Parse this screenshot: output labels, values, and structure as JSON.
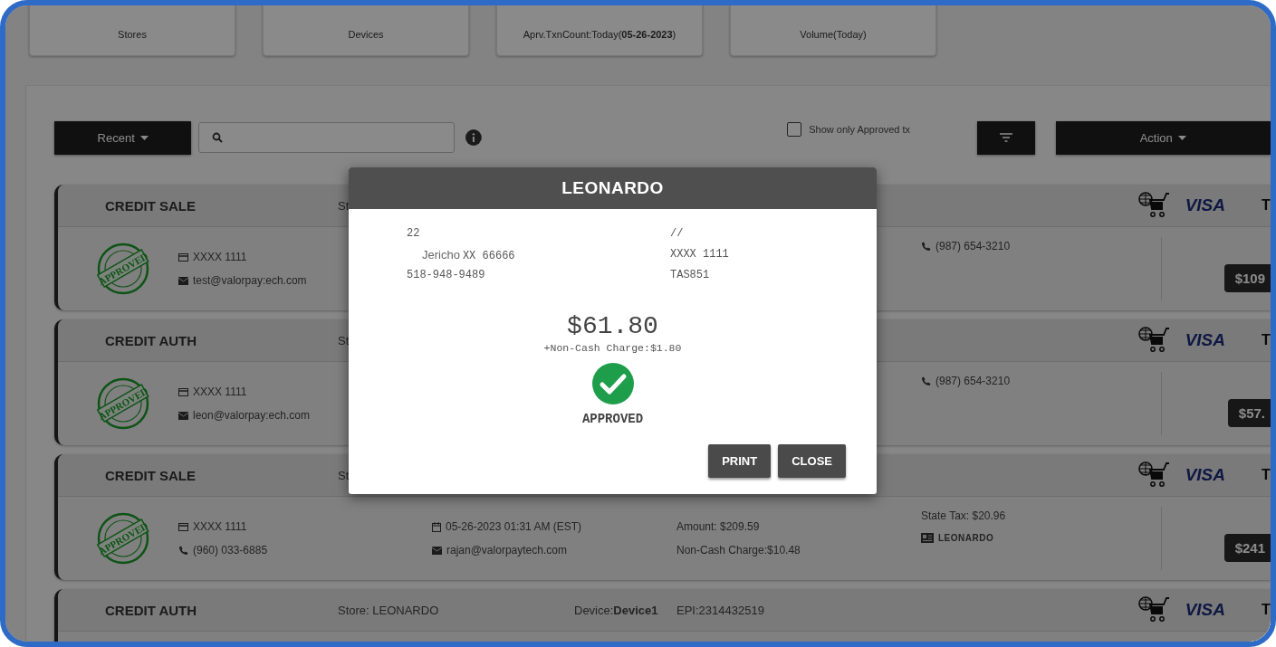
{
  "stats": [
    {
      "label": "Stores"
    },
    {
      "label": "Devices"
    },
    {
      "label": "Aprv.TxnCount:Today(**05-26-2023**)"
    },
    {
      "label": "Volume(Today)"
    }
  ],
  "toolbar": {
    "recent_button": "Recent",
    "approved_filter": {
      "label": "Show only Approved tx",
      "checked": false
    },
    "action_button": "Action"
  },
  "transactions": [
    {
      "type": "CREDIT SALE",
      "header_fields": [
        "St"
      ],
      "brand": "VISA",
      "cut_column": "T",
      "stamp": "APPROVED",
      "column_1": [
        {
          "kind": "card",
          "text": "XXXX 1111"
        },
        {
          "kind": "mail",
          "text": "test@valorpay:ech.com"
        }
      ],
      "column_4": [
        {
          "kind": "phone",
          "text": "(987) 654-3210"
        }
      ],
      "amount": "$109"
    },
    {
      "type": "CREDIT AUTH",
      "header_fields": [
        "St"
      ],
      "brand": "VISA",
      "cut_column": "T",
      "stamp": "APPROVED",
      "column_1": [
        {
          "kind": "card",
          "text": "XXXX 1111"
        },
        {
          "kind": "mail",
          "text": "leon@valorpay:ech.com"
        }
      ],
      "column_4": [
        {
          "kind": "phone",
          "text": "(987) 654-3210"
        }
      ],
      "amount": "$57."
    },
    {
      "type": "CREDIT SALE",
      "header_fields": [
        "St"
      ],
      "brand": "VISA",
      "cut_column": "T",
      "stamp": "APPROVED",
      "column_1": [
        {
          "kind": "card",
          "text": "XXXX 1111"
        },
        {
          "kind": "phone",
          "text": "(960) 033-6885"
        }
      ],
      "column_2": [
        {
          "kind": "calendar",
          "text": "05-26-2023 01:31 AM (EST)"
        },
        {
          "kind": "mail",
          "text": "rajan@valorpaytech.com"
        }
      ],
      "column_3": [
        {
          "text": "Amount: $209.59"
        },
        {
          "text": "Non-Cash Charge:$10.48"
        }
      ],
      "column_4": [
        {
          "text": "State Tax: $20.96"
        },
        {
          "kind": "store",
          "text": "LEONARDO"
        }
      ],
      "amount": "$241"
    },
    {
      "type": "CREDIT AUTH",
      "header_fields": [
        "Store: LEONARDO",
        "Device:**Device1**",
        "EPI:2314432519"
      ],
      "brand": "VISA",
      "cut_column": "T"
    }
  ],
  "modal": {
    "title": "LEONARDO",
    "merchant": {
      "line_1": "22",
      "city": "Jericho",
      "zip_line": "XX 66666",
      "phone": "518-948-9489"
    },
    "details": {
      "date": "//",
      "card": "XXXX 1111",
      "ref": "TAS851"
    },
    "amount": "$61.80",
    "fee": "+Non-Cash Charge:$1.80",
    "status": "APPROVED",
    "buttons": [
      "PRINT",
      "CLOSE"
    ]
  }
}
